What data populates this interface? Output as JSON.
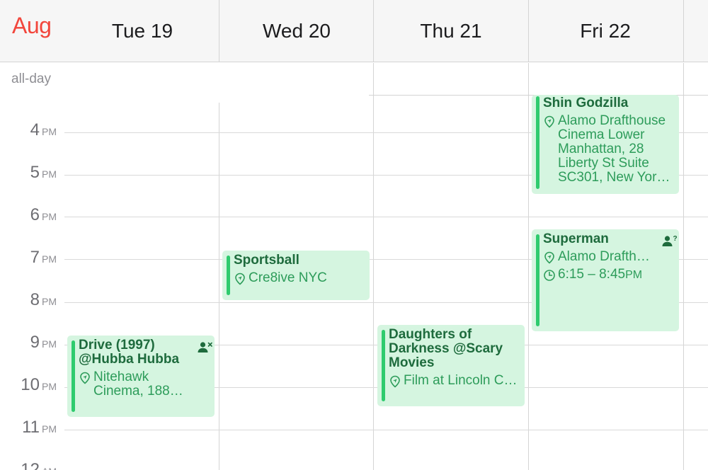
{
  "header": {
    "month": "Aug",
    "days": [
      {
        "label": "Tue 19"
      },
      {
        "label": "Wed 20"
      },
      {
        "label": "Thu 21"
      },
      {
        "label": "Fri 22"
      }
    ]
  },
  "allday_label": "all-day",
  "hours": [
    {
      "num": "4",
      "ap": "PM"
    },
    {
      "num": "5",
      "ap": "PM"
    },
    {
      "num": "6",
      "ap": "PM"
    },
    {
      "num": "7",
      "ap": "PM"
    },
    {
      "num": "8",
      "ap": "PM"
    },
    {
      "num": "9",
      "ap": "PM"
    },
    {
      "num": "10",
      "ap": "PM"
    },
    {
      "num": "11",
      "ap": "PM"
    },
    {
      "num": "12",
      "ap": "AM"
    }
  ],
  "events": {
    "shin_godzilla": {
      "title": "Shin Godzilla",
      "location": "Alamo Drafthouse Cinema Lower Manhattan, 28 Liberty St Suite SC301, New Yor…"
    },
    "superman": {
      "title": "Superman",
      "location": "Alamo Drafth…",
      "time": "6:15 – 8:45",
      "time_suffix": "PM",
      "status_icon": "person-question-icon"
    },
    "sportsball": {
      "title": "Sportsball",
      "location": "Cre8ive NYC"
    },
    "drive": {
      "title": "Drive (1997) @Hubba Hubba",
      "location": "Nitehawk Cinema, 188…",
      "status_icon": "person-declined-icon"
    },
    "daughters": {
      "title": "Daughters of Darkness @Scary Movies",
      "location": "Film at Lincoln C…"
    }
  },
  "colors": {
    "accent_red": "#f2463c",
    "event_bg": "#d5f5e0",
    "event_bar": "#2fcb6e",
    "event_title": "#1e6b3d",
    "event_text": "#2d9c5a"
  }
}
